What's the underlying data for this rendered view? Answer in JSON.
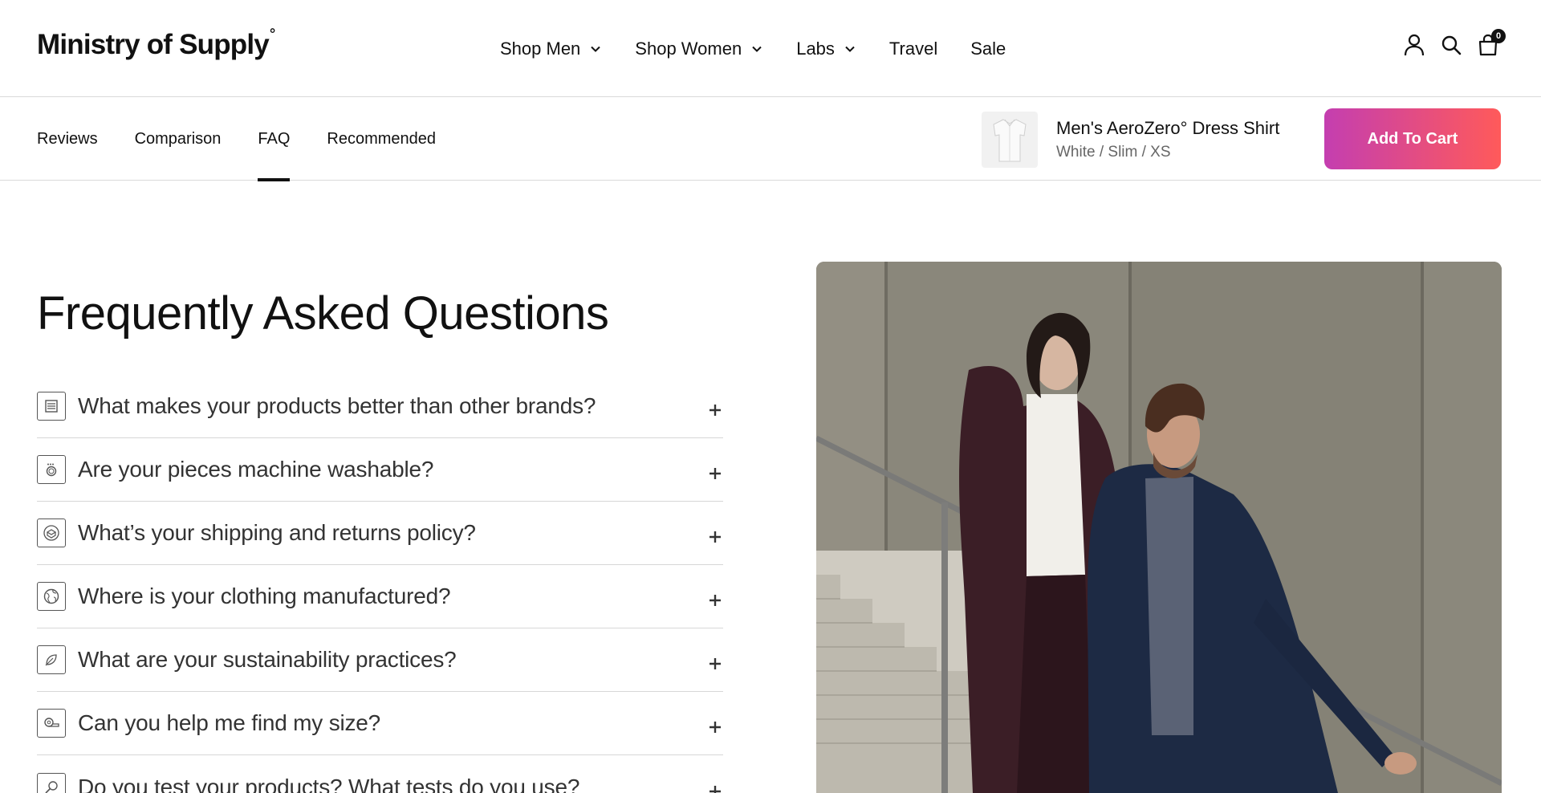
{
  "header": {
    "logo": "Ministry of Supply",
    "logo_mark": "°",
    "nav": [
      {
        "label": "Shop Men",
        "has_dropdown": true
      },
      {
        "label": "Shop Women",
        "has_dropdown": true
      },
      {
        "label": "Labs",
        "has_dropdown": true
      },
      {
        "label": "Travel",
        "has_dropdown": false
      },
      {
        "label": "Sale",
        "has_dropdown": false
      }
    ],
    "icons": [
      "account-icon",
      "search-icon",
      "bag-icon"
    ],
    "cart_count": "0"
  },
  "subnav": {
    "tabs": [
      {
        "label": "Reviews",
        "active": false
      },
      {
        "label": "Comparison",
        "active": false
      },
      {
        "label": "FAQ",
        "active": true
      },
      {
        "label": "Recommended",
        "active": false
      }
    ],
    "product": {
      "name": "Men's AeroZero° Dress Shirt",
      "variant": "White / Slim / XS"
    },
    "add_to_cart_label": "Add To Cart"
  },
  "faq": {
    "title": "Frequently Asked Questions",
    "items": [
      {
        "question": "What makes your products better than other brands?",
        "icon": "fabric-layers-icon"
      },
      {
        "question": "Are your pieces machine washable?",
        "icon": "washing-machine-icon"
      },
      {
        "question": "What’s your shipping and returns policy?",
        "icon": "shipping-box-icon"
      },
      {
        "question": "Where is your clothing manufactured?",
        "icon": "globe-icon"
      },
      {
        "question": "What are your sustainability practices?",
        "icon": "leaf-icon"
      },
      {
        "question": "Can you help me find my size?",
        "icon": "measuring-tape-icon"
      },
      {
        "question": "Do you test your products? What tests do you use?",
        "icon": "magnifier-icon"
      }
    ],
    "expand_symbol": "+"
  },
  "colors": {
    "cta_gradient_start": "#c43eb0",
    "cta_gradient_end": "#ff5a5a",
    "text_primary": "#111111",
    "text_secondary": "#666666",
    "divider": "#d9d9d9"
  }
}
